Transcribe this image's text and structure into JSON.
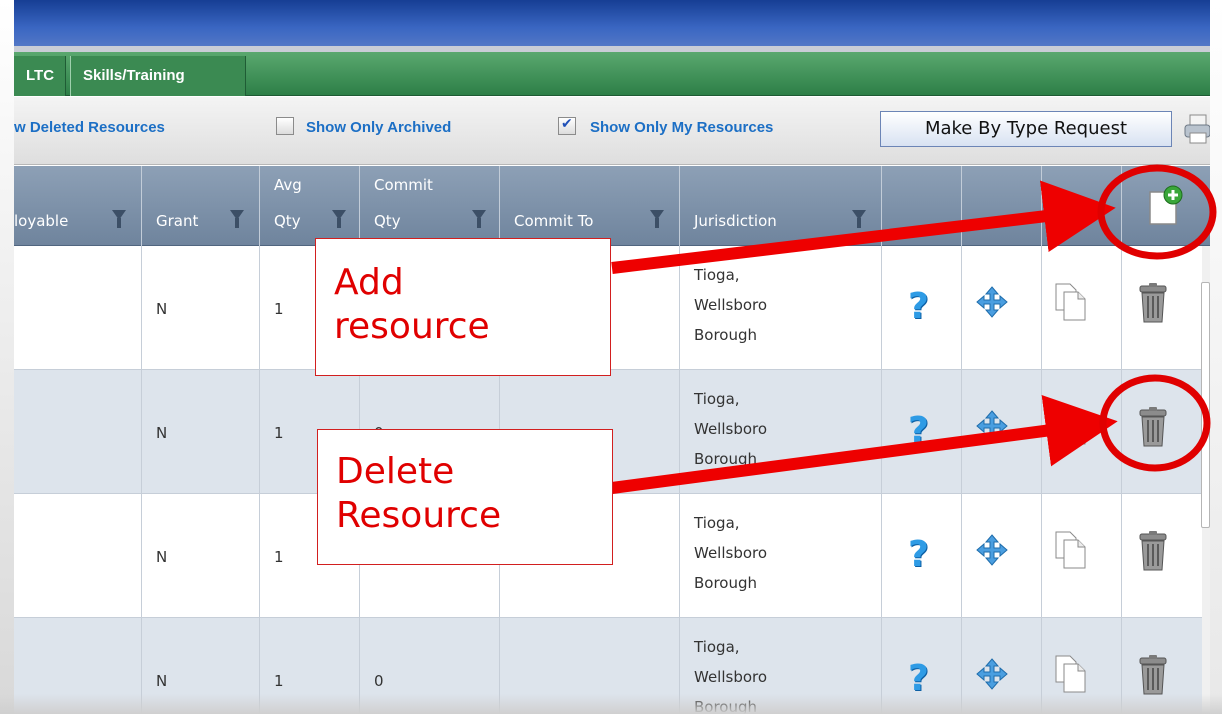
{
  "tabs": [
    {
      "label": "LTC"
    },
    {
      "label": "Skills/Training"
    }
  ],
  "toolbar": {
    "show_deleted_label": "w Deleted Resources",
    "show_archived_label": "Show Only Archived",
    "show_archived_checked": false,
    "show_mine_label": "Show Only My Resources",
    "show_mine_checked": true,
    "make_request_label": "Make By Type Request"
  },
  "columns": {
    "deployable": "loyable",
    "grant": "Grant",
    "avg_qty_line1": "Avg",
    "avg_qty_line2": "Qty",
    "commit_qty_line1": "Commit",
    "commit_qty_line2": "Qty",
    "commit_to": "Commit To",
    "jurisdiction": "Jurisdiction"
  },
  "rows": [
    {
      "grant": "N",
      "avg_qty": "1",
      "commit_qty": "",
      "commit_to": "",
      "jurisdiction_1": "Tioga,",
      "jurisdiction_2": "Wellsboro",
      "jurisdiction_3": "Borough"
    },
    {
      "grant": "N",
      "avg_qty": "1",
      "commit_qty": "0",
      "commit_to": "",
      "jurisdiction_1": "Tioga,",
      "jurisdiction_2": "Wellsboro",
      "jurisdiction_3": "Borough"
    },
    {
      "grant": "N",
      "avg_qty": "1",
      "commit_qty": "",
      "commit_to": "",
      "jurisdiction_1": "Tioga,",
      "jurisdiction_2": "Wellsboro",
      "jurisdiction_3": "Borough"
    },
    {
      "grant": "N",
      "avg_qty": "1",
      "commit_qty": "0",
      "commit_to": "",
      "jurisdiction_1": "Tioga,",
      "jurisdiction_2": "Wellsboro",
      "jurisdiction_3": "Borough"
    }
  ],
  "annotations": {
    "add_line1": "Add",
    "add_line2": "resource",
    "delete_line1": "Delete",
    "delete_line2": "Resource"
  },
  "icons": {
    "help": "question-mark-icon",
    "move": "move-arrows-icon",
    "copy": "copy-document-icon",
    "delete": "trash-icon",
    "add": "add-document-icon",
    "print": "printer-icon"
  },
  "colors": {
    "title_bar": "#2f5bb7",
    "tab_bar": "#2d7f47",
    "link": "#1c6fc5",
    "header": "#7f93aa",
    "row_alt": "#dde4ec",
    "annotation": "#e00000"
  }
}
